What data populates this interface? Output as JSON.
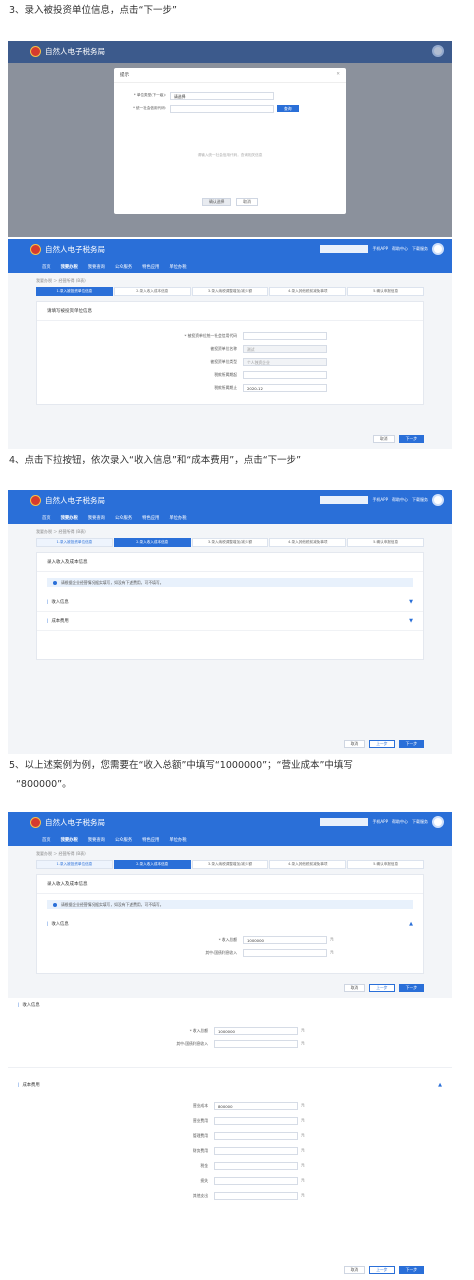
{
  "steps": {
    "s3": "3、录入被投资单位信息，点击“下一步”",
    "s4": "4、点击下拉按钮，依次录入“收入信息”和“成本费用”，点击“下一步”",
    "s5a": "5、以上述案例为例，您需要在“收入总额”中填写“1000000”；“营业成本”中填写",
    "s5b": "“800000”。"
  },
  "app": {
    "title": "自然人电子税务局",
    "header_links": [
      "手机APP",
      "帮助中心",
      "下载服务"
    ],
    "nav": [
      "首页",
      "我要办税",
      "我要查询",
      "公众服务",
      "特色应用",
      "单位办税"
    ],
    "breadcrumb": "我要办税 ＞ 经营所得 (B表)"
  },
  "progress_steps": [
    "1.录入被投资单位信息",
    "2.录入收入成本信息",
    "3.录入纳税调整增加/减少额",
    "4.录入其他税前减免事项",
    "5.确认申报信息"
  ],
  "modal": {
    "title": "提示",
    "type_label": "* 单位类型(下一级):",
    "type_value": "请选择",
    "code_label": "* 统一社会信用代码:",
    "search_btn": "查询",
    "empty_hint": "请输入统一社会信用代码，查询相关信息",
    "confirm_btn": "确认选择",
    "cancel_btn": "取消"
  },
  "s3_form": {
    "title": "请填写被投资单位信息",
    "fields": [
      {
        "label": "* 被投资单位统一社会信用代码",
        "value": ""
      },
      {
        "label": "被投资单位名称",
        "value": "测试"
      },
      {
        "label": "被投资单位类型",
        "value": "个人独资企业"
      },
      {
        "label": "税款所属期起",
        "value": ""
      },
      {
        "label": "税款所属期止",
        "value": "2020-12"
      }
    ]
  },
  "s4_form": {
    "title": "录入收入及成本信息",
    "note": "请根据企业经营情况据实填写，如没有下述费用，可不填写。",
    "income": "收入信息",
    "cost": "成本费用"
  },
  "s5_form": {
    "income_total_label": "* 收入总额",
    "income_total": "1000000",
    "nontax_label": "其中:国债利息收入",
    "unit": "元",
    "cost_rows": [
      {
        "label": "营业成本",
        "value": "800000"
      },
      {
        "label": "营业费用",
        "value": ""
      },
      {
        "label": "管理费用",
        "value": ""
      },
      {
        "label": "财务费用",
        "value": ""
      },
      {
        "label": "税金",
        "value": ""
      },
      {
        "label": "损失",
        "value": ""
      },
      {
        "label": "其他支出",
        "value": ""
      }
    ]
  },
  "buttons": {
    "cancel": "取消",
    "prev": "上一步",
    "next": "下一步"
  },
  "colors": {
    "brand": "#2a6fd8",
    "header_red": "#d63b2e"
  }
}
